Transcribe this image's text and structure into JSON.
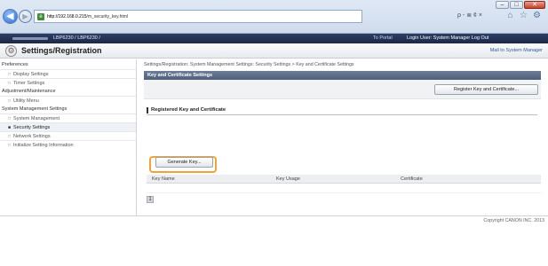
{
  "browser": {
    "url_host": "http://192.168.0.215",
    "url_path": "/m_security_key.html",
    "search_hint": "ρ - ≣ ¢ ×"
  },
  "devbar": {
    "model": "LBP6230 / LBP6230 /",
    "portal_link": "To Portal",
    "login_user": "Login User: System Manager  Log Out"
  },
  "header": {
    "title": "Settings/Registration",
    "mail_link": "Mail to System Manager"
  },
  "sidebar": {
    "sections": [
      {
        "label": "Preferences",
        "items": [
          {
            "label": "Display Settings"
          },
          {
            "label": "Timer Settings"
          }
        ]
      },
      {
        "label": "Adjustment/Maintenance",
        "items": [
          {
            "label": "Utility Menu"
          }
        ]
      },
      {
        "label": "System Management Settings",
        "items": [
          {
            "label": "System Management"
          },
          {
            "label": "Security Settings",
            "active": true
          },
          {
            "label": "Network Settings"
          },
          {
            "label": "Initialize Setting Information"
          }
        ]
      }
    ]
  },
  "main": {
    "breadcrumb": "Settings/Registration: System Management Settings: Security Settings > Key and Certificate Settings",
    "panel_title": "Key and Certificate Settings",
    "register_button": "Register Key and Certificate...",
    "section_title": "Registered Key and Certificate",
    "generate_button": "Generate Key...",
    "table_headers": [
      "Key Name",
      "Key Usage",
      "Certificate"
    ],
    "pager_label": "1"
  },
  "footer": {
    "copyright": "Copyright CANON INC. 2013"
  },
  "colors": {
    "highlight": "#f1a33a",
    "devbar": "#1c2846",
    "panel_header": "#5a6a85"
  }
}
